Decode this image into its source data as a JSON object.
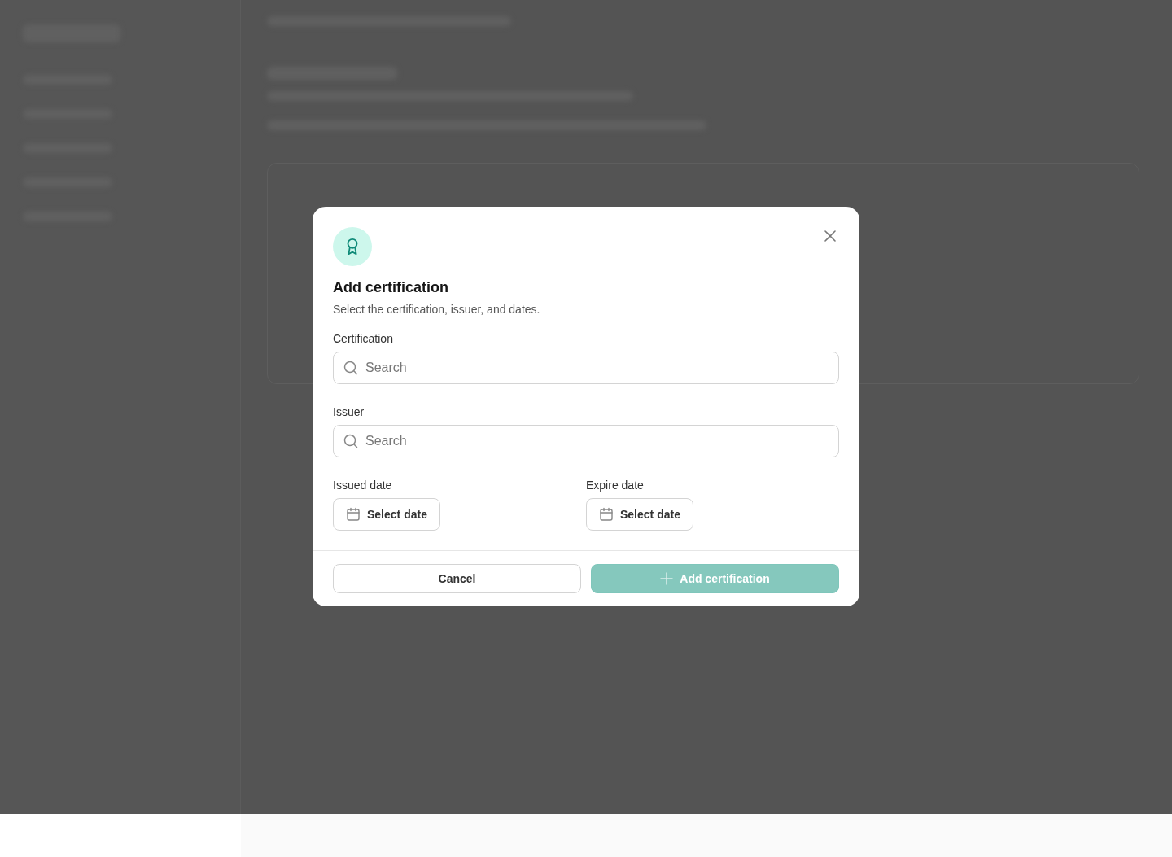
{
  "dialog": {
    "title": "Add certification",
    "subtitle": "Select the certification, issuer, and dates.",
    "fields": [
      {
        "label": "Certification",
        "placeholder": "Search"
      },
      {
        "label": "Issuer",
        "placeholder": "Search"
      }
    ],
    "dates": [
      {
        "label": "Issued date",
        "button": "Select date"
      },
      {
        "label": "Expire date",
        "button": "Select date"
      }
    ],
    "cancel": "Cancel",
    "submit": {
      "label": "Add certification",
      "disabled": true
    }
  }
}
